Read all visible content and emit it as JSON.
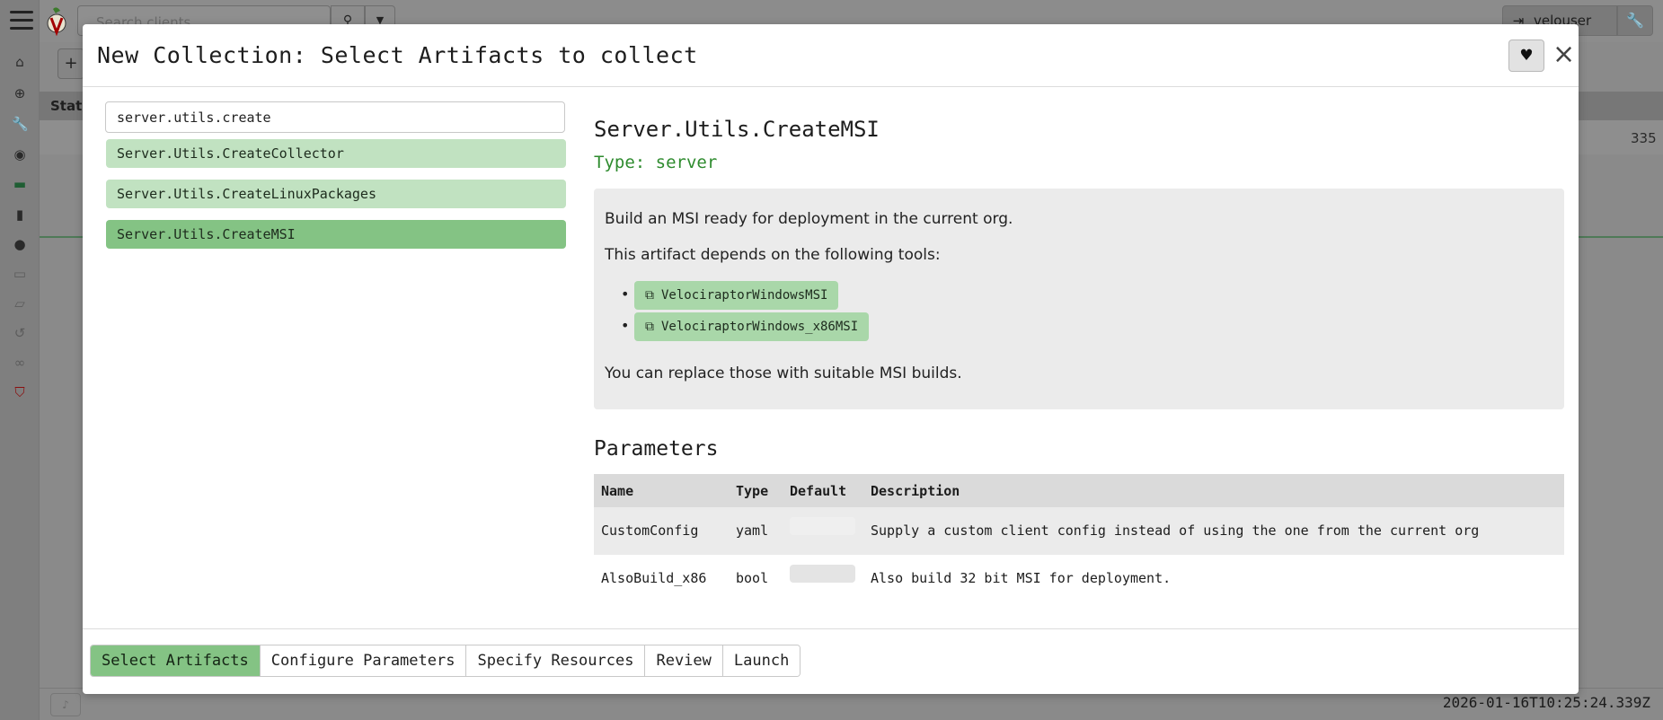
{
  "background": {
    "search_placeholder": "Search clients",
    "username": "velouser",
    "table_header_first": "Stat",
    "row_value": "335",
    "timestamp": "2026-01-16T10:25:24.339Z"
  },
  "modal": {
    "title": "New Collection: Select Artifacts to collect",
    "search_value": "server.utils.create",
    "artifacts": [
      {
        "name": "Server.Utils.CreateCollector",
        "selected": false
      },
      {
        "name": "Server.Utils.CreateLinuxPackages",
        "selected": false
      },
      {
        "name": "Server.Utils.CreateMSI",
        "selected": true
      }
    ],
    "detail": {
      "name": "Server.Utils.CreateMSI",
      "type_label": "Type: server",
      "description": "Build an MSI ready for deployment in the current org.",
      "depends_text": "This artifact depends on the following tools:",
      "tools": [
        "VelociraptorWindowsMSI",
        "VelociraptorWindows_x86MSI"
      ],
      "replace_text": "You can replace those with suitable MSI builds."
    },
    "parameters": {
      "title": "Parameters",
      "columns": [
        "Name",
        "Type",
        "Default",
        "Description"
      ],
      "rows": [
        {
          "name": "CustomConfig",
          "type": "yaml",
          "default": "",
          "description": "Supply a custom client config instead of using the one from the current org"
        },
        {
          "name": "AlsoBuild_x86",
          "type": "bool",
          "default": "",
          "description": "Also build 32 bit MSI for deployment."
        }
      ]
    },
    "wizard_steps": [
      "Select Artifacts",
      "Configure Parameters",
      "Specify Resources",
      "Review",
      "Launch"
    ],
    "active_step": "Select Artifacts"
  },
  "colors": {
    "accent_green": "#84c384",
    "light_green": "#c1e2c1",
    "type_green": "#2e8b2e"
  }
}
